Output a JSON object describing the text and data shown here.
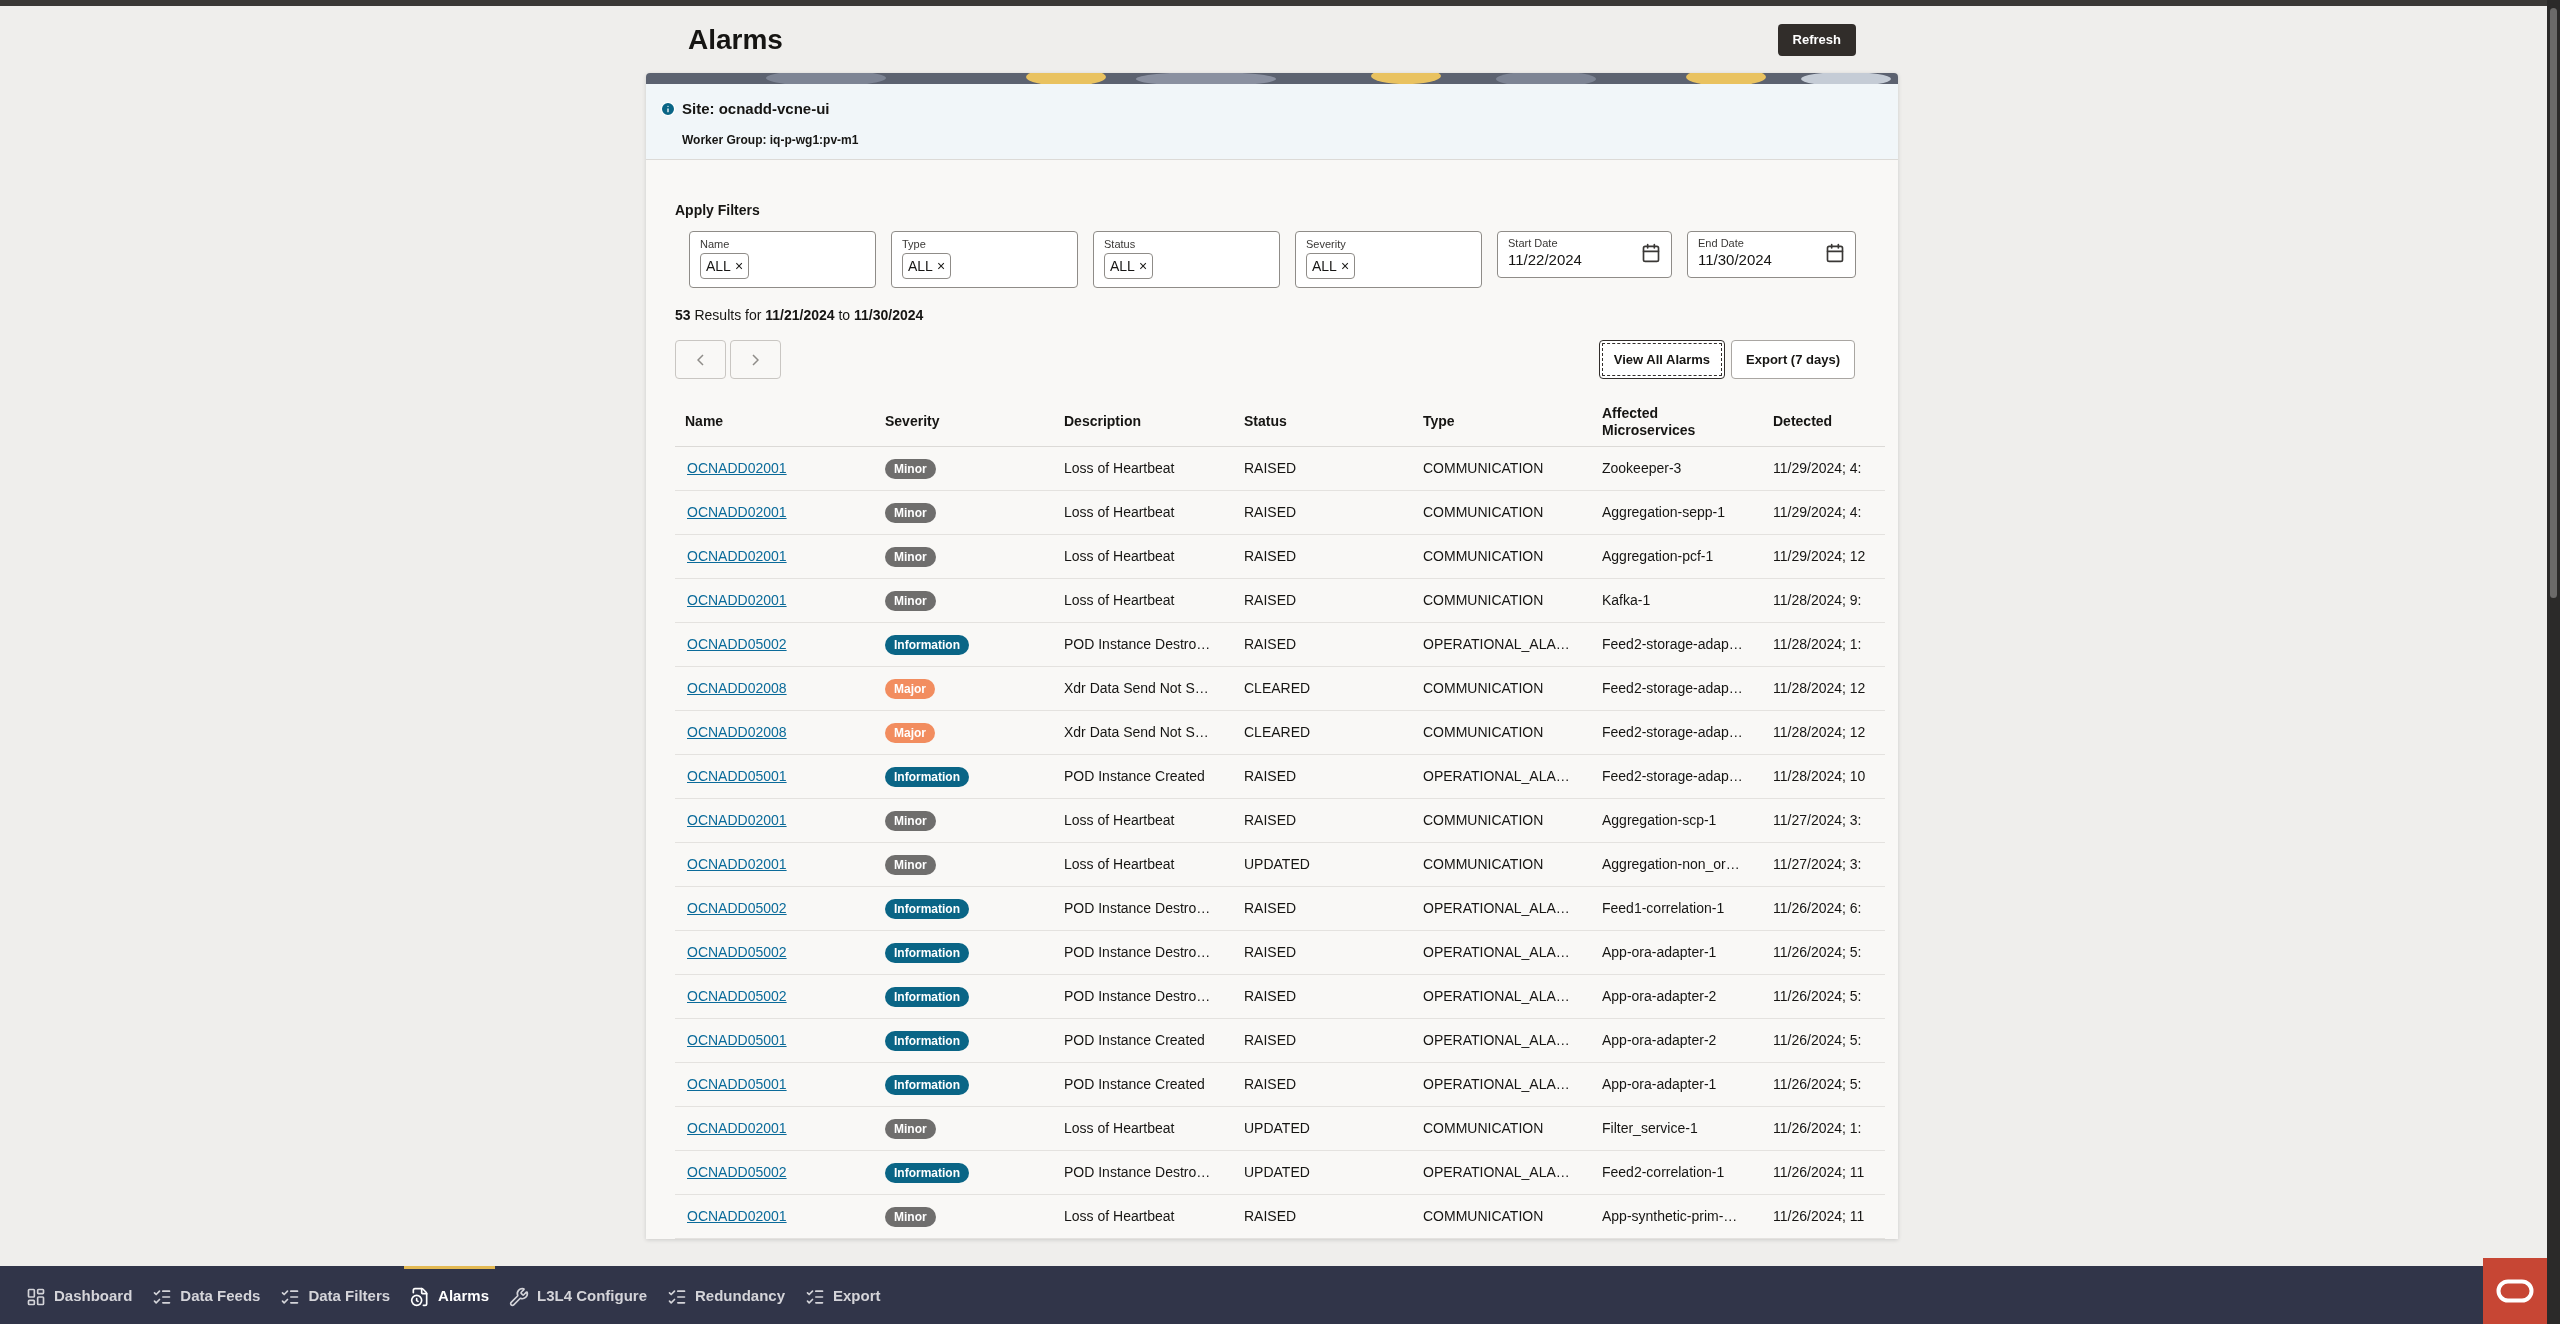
{
  "page": {
    "title": "Alarms",
    "refresh_button": "Refresh"
  },
  "site": {
    "label": "Site: ocnadd-vcne-ui",
    "worker_group": "Worker Group: iq-p-wg1:pv-m1"
  },
  "filters": {
    "heading": "Apply Filters",
    "items": [
      {
        "kind": "multi",
        "label": "Name",
        "chip": "ALL",
        "remove": "×"
      },
      {
        "kind": "multi",
        "label": "Type",
        "chip": "ALL",
        "remove": "×"
      },
      {
        "kind": "multi",
        "label": "Status",
        "chip": "ALL",
        "remove": "×"
      },
      {
        "kind": "multi",
        "label": "Severity",
        "chip": "ALL",
        "remove": "×"
      },
      {
        "kind": "date",
        "label": "Start Date",
        "value": "11/22/2024"
      },
      {
        "kind": "date",
        "label": "End Date",
        "value": "11/30/2024"
      }
    ]
  },
  "results": "**53** Results for **11/21/2024** to **11/30/2024**",
  "actions": [
    {
      "label": "View All Alarms",
      "focused": true
    },
    {
      "label": "Export (7 days)",
      "focused": false
    }
  ],
  "table": {
    "columns": [
      "Name",
      "Severity",
      "Description",
      "Status",
      "Type",
      "Affected Microservices",
      "Detected"
    ],
    "rows": [
      {
        "name": "OCNADD02001",
        "severity": "Minor",
        "color": "#6f6e6d",
        "description": "Loss of Heartbeat",
        "status": "RAISED",
        "type": "COMMUNICATION",
        "affected": "Zookeeper-3",
        "detected": "11/29/2024; 4:"
      },
      {
        "name": "OCNADD02001",
        "severity": "Minor",
        "color": "#6f6e6d",
        "description": "Loss of Heartbeat",
        "status": "RAISED",
        "type": "COMMUNICATION",
        "affected": "Aggregation-sepp-1",
        "detected": "11/29/2024; 4:"
      },
      {
        "name": "OCNADD02001",
        "severity": "Minor",
        "color": "#6f6e6d",
        "description": "Loss of Heartbeat",
        "status": "RAISED",
        "type": "COMMUNICATION",
        "affected": "Aggregation-pcf-1",
        "detected": "11/29/2024; 12"
      },
      {
        "name": "OCNADD02001",
        "severity": "Minor",
        "color": "#6f6e6d",
        "description": "Loss of Heartbeat",
        "status": "RAISED",
        "type": "COMMUNICATION",
        "affected": "Kafka-1",
        "detected": "11/28/2024; 9:"
      },
      {
        "name": "OCNADD05002",
        "severity": "Information",
        "color": "#0a6586",
        "description": "POD Instance Destro…",
        "status": "RAISED",
        "type": "OPERATIONAL_ALA…",
        "affected": "Feed2-storage-adap…",
        "detected": "11/28/2024; 1:"
      },
      {
        "name": "OCNADD02008",
        "severity": "Major",
        "color": "#f28d5f",
        "description": "Xdr Data Send Not S…",
        "status": "CLEARED",
        "type": "COMMUNICATION",
        "affected": "Feed2-storage-adap…",
        "detected": "11/28/2024; 12"
      },
      {
        "name": "OCNADD02008",
        "severity": "Major",
        "color": "#f28d5f",
        "description": "Xdr Data Send Not S…",
        "status": "CLEARED",
        "type": "COMMUNICATION",
        "affected": "Feed2-storage-adap…",
        "detected": "11/28/2024; 12"
      },
      {
        "name": "OCNADD05001",
        "severity": "Information",
        "color": "#0a6586",
        "description": "POD Instance Created",
        "status": "RAISED",
        "type": "OPERATIONAL_ALA…",
        "affected": "Feed2-storage-adap…",
        "detected": "11/28/2024; 10"
      },
      {
        "name": "OCNADD02001",
        "severity": "Minor",
        "color": "#6f6e6d",
        "description": "Loss of Heartbeat",
        "status": "RAISED",
        "type": "COMMUNICATION",
        "affected": "Aggregation-scp-1",
        "detected": "11/27/2024; 3:"
      },
      {
        "name": "OCNADD02001",
        "severity": "Minor",
        "color": "#6f6e6d",
        "description": "Loss of Heartbeat",
        "status": "UPDATED",
        "type": "COMMUNICATION",
        "affected": "Aggregation-non_or…",
        "detected": "11/27/2024; 3:"
      },
      {
        "name": "OCNADD05002",
        "severity": "Information",
        "color": "#0a6586",
        "description": "POD Instance Destro…",
        "status": "RAISED",
        "type": "OPERATIONAL_ALA…",
        "affected": "Feed1-correlation-1",
        "detected": "11/26/2024; 6:"
      },
      {
        "name": "OCNADD05002",
        "severity": "Information",
        "color": "#0a6586",
        "description": "POD Instance Destro…",
        "status": "RAISED",
        "type": "OPERATIONAL_ALA…",
        "affected": "App-ora-adapter-1",
        "detected": "11/26/2024; 5:"
      },
      {
        "name": "OCNADD05002",
        "severity": "Information",
        "color": "#0a6586",
        "description": "POD Instance Destro…",
        "status": "RAISED",
        "type": "OPERATIONAL_ALA…",
        "affected": "App-ora-adapter-2",
        "detected": "11/26/2024; 5:"
      },
      {
        "name": "OCNADD05001",
        "severity": "Information",
        "color": "#0a6586",
        "description": "POD Instance Created",
        "status": "RAISED",
        "type": "OPERATIONAL_ALA…",
        "affected": "App-ora-adapter-2",
        "detected": "11/26/2024; 5:"
      },
      {
        "name": "OCNADD05001",
        "severity": "Information",
        "color": "#0a6586",
        "description": "POD Instance Created",
        "status": "RAISED",
        "type": "OPERATIONAL_ALA…",
        "affected": "App-ora-adapter-1",
        "detected": "11/26/2024; 5:"
      },
      {
        "name": "OCNADD02001",
        "severity": "Minor",
        "color": "#6f6e6d",
        "description": "Loss of Heartbeat",
        "status": "UPDATED",
        "type": "COMMUNICATION",
        "affected": "Filter_service-1",
        "detected": "11/26/2024; 1:"
      },
      {
        "name": "OCNADD05002",
        "severity": "Information",
        "color": "#0a6586",
        "description": "POD Instance Destro…",
        "status": "UPDATED",
        "type": "OPERATIONAL_ALA…",
        "affected": "Feed2-correlation-1",
        "detected": "11/26/2024; 11"
      },
      {
        "name": "OCNADD02001",
        "severity": "Minor",
        "color": "#6f6e6d",
        "description": "Loss of Heartbeat",
        "status": "RAISED",
        "type": "COMMUNICATION",
        "affected": "App-synthetic-prim-…",
        "detected": "11/26/2024; 11"
      }
    ]
  },
  "nav": [
    {
      "kind": "dashboard",
      "label": "Dashboard",
      "selected": false
    },
    {
      "kind": "list",
      "label": "Data Feeds",
      "selected": false
    },
    {
      "kind": "list",
      "label": "Data Filters",
      "selected": false
    },
    {
      "kind": "alarm",
      "label": "Alarms",
      "selected": true
    },
    {
      "kind": "tools",
      "label": "L3L4 Configure",
      "selected": false
    },
    {
      "kind": "list",
      "label": "Redundancy",
      "selected": false
    },
    {
      "kind": "list",
      "label": "Export",
      "selected": false
    }
  ]
}
